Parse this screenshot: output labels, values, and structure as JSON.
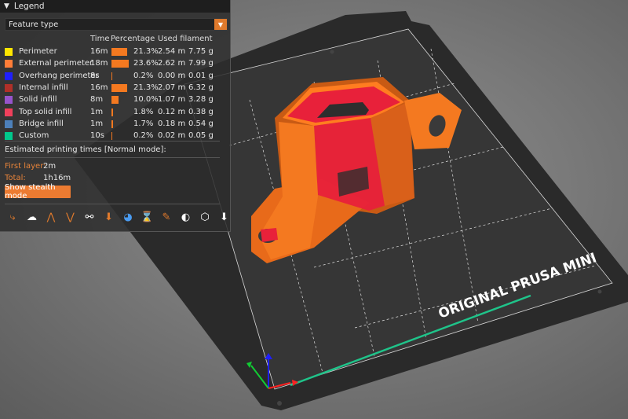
{
  "legend": {
    "title": "Legend",
    "selector_value": "Feature type",
    "columns": {
      "time": "Time",
      "percentage": "Percentage",
      "filament": "Used filament"
    },
    "features": [
      {
        "name": "Perimeter",
        "color": "#ffe600",
        "time": "16m",
        "percent": "21.3%",
        "percent_value": 21.3,
        "length": "2.54 m",
        "weight": "7.75 g"
      },
      {
        "name": "External perimeter",
        "color": "#ff7d38",
        "time": "18m",
        "percent": "23.6%",
        "percent_value": 23.6,
        "length": "2.62 m",
        "weight": "7.99 g"
      },
      {
        "name": "Overhang perimeter",
        "color": "#1f1fff",
        "time": "8s",
        "percent": "0.2%",
        "percent_value": 0.2,
        "length": "0.00 m",
        "weight": "0.01 g"
      },
      {
        "name": "Internal infill",
        "color": "#b03029",
        "time": "16m",
        "percent": "21.3%",
        "percent_value": 21.3,
        "length": "2.07 m",
        "weight": "6.32 g"
      },
      {
        "name": "Solid infill",
        "color": "#9654cc",
        "time": "8m",
        "percent": "10.0%",
        "percent_value": 10.0,
        "length": "1.07 m",
        "weight": "3.28 g"
      },
      {
        "name": "Top solid infill",
        "color": "#f0405c",
        "time": "1m",
        "percent": "1.8%",
        "percent_value": 1.8,
        "length": "0.12 m",
        "weight": "0.38 g"
      },
      {
        "name": "Bridge infill",
        "color": "#4d80ba",
        "time": "1m",
        "percent": "1.7%",
        "percent_value": 1.7,
        "length": "0.18 m",
        "weight": "0.54 g"
      },
      {
        "name": "Custom",
        "color": "#00c88c",
        "time": "10s",
        "percent": "0.2%",
        "percent_value": 0.2,
        "length": "0.02 m",
        "weight": "0.05 g"
      }
    ],
    "estimate_heading": "Estimated printing times [Normal mode]:",
    "first_layer_label": "First layer:",
    "first_layer_value": "2m",
    "total_label": "Total:",
    "total_value": "1h16m",
    "stealth_button": "Show stealth mode",
    "toolbar_icons": [
      "travel-icon",
      "wipe-icon",
      "retractions-icon",
      "deretractions-icon",
      "seams-icon",
      "tool-changes-icon",
      "color-changes-icon",
      "pause-prints-icon",
      "custom-gcodes-icon",
      "center-of-gravity-icon",
      "shells-icon",
      "tool-marker-icon"
    ]
  },
  "bed": {
    "label": "ORIGINAL PRUSA MINI"
  },
  "colors": {
    "accent": "#ec7b31",
    "model": "#f47920",
    "model_top": "#e8213a"
  }
}
